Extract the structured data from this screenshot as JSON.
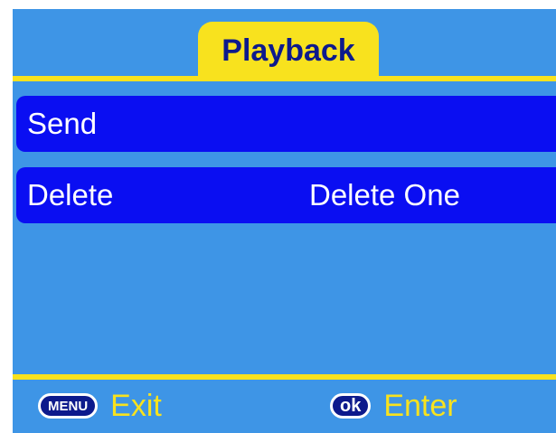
{
  "header": {
    "title": "Playback"
  },
  "menu": {
    "items": [
      {
        "label": "Send",
        "value": ""
      },
      {
        "label": "Delete",
        "value": "Delete One"
      }
    ]
  },
  "footer": {
    "menu_key": "MENU",
    "menu_action": "Exit",
    "ok_key": "ok",
    "ok_action": "Enter"
  },
  "colors": {
    "background": "#3e95e6",
    "accent": "#f8e21e",
    "row_highlight": "#0a0ef2",
    "tab_text": "#0d1a8c"
  }
}
